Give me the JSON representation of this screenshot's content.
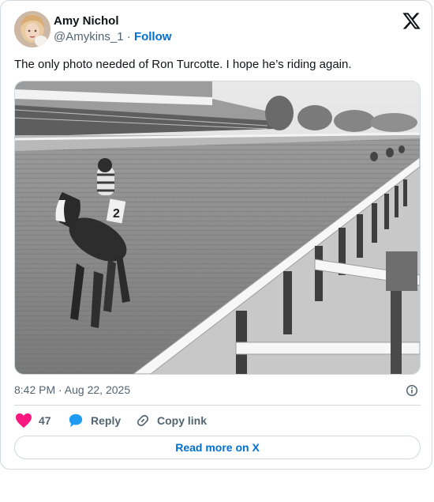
{
  "author": {
    "name": "Amy Nichol",
    "handle": "@Amykins_1",
    "separator": "·",
    "follow_label": "Follow"
  },
  "tweet": {
    "text": "The only photo needed of Ron Turcotte. I hope he’s riding again.",
    "timestamp": "8:42 PM · Aug 22, 2025"
  },
  "media": {
    "description_icon": "photo",
    "saddle_number": "2"
  },
  "actions": {
    "like_count": "47",
    "reply_label": "Reply",
    "copy_label": "Copy link"
  },
  "footer": {
    "read_more_label": "Read more on X"
  },
  "colors": {
    "link": "#006fd6",
    "like": "#f91880",
    "reply": "#1d9bf0",
    "muted": "#536471",
    "border": "#cfd9de"
  },
  "icons": [
    "x-logo-icon",
    "info-icon",
    "heart-icon",
    "reply-bubble-icon",
    "link-icon"
  ]
}
